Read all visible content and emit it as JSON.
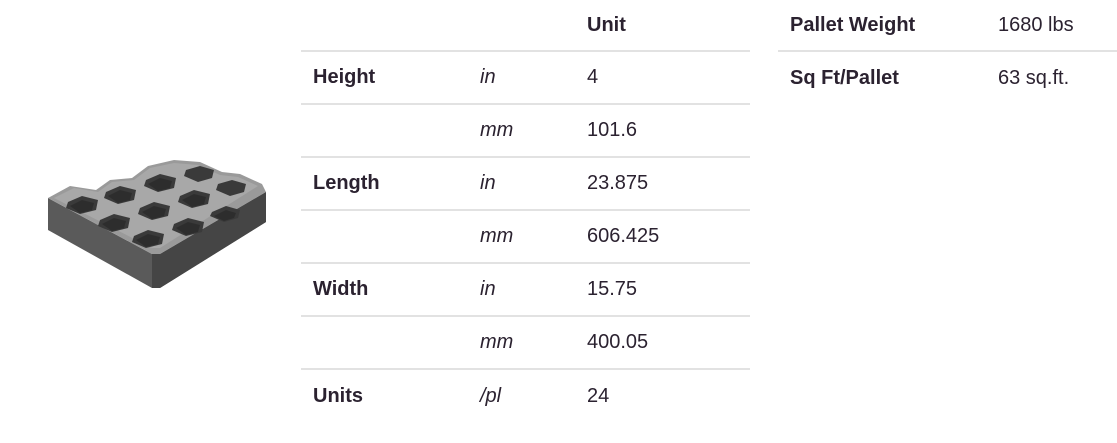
{
  "product": {
    "image_name": "turf-paver-block"
  },
  "spec_table": {
    "header": {
      "unit_label": "Unit"
    },
    "rows": [
      {
        "label": "Height",
        "unit": "in",
        "value": "4"
      },
      {
        "label": "",
        "unit": "mm",
        "value": "101.6"
      },
      {
        "label": "Length",
        "unit": "in",
        "value": "23.875"
      },
      {
        "label": "",
        "unit": "mm",
        "value": "606.425"
      },
      {
        "label": "Width",
        "unit": "in",
        "value": "15.75"
      },
      {
        "label": "",
        "unit": "mm",
        "value": "400.05"
      },
      {
        "label": "Units",
        "unit": "/pl",
        "value": "24"
      }
    ]
  },
  "pallet_table": {
    "rows": [
      {
        "label": "Pallet Weight",
        "value": "1680 lbs"
      },
      {
        "label": "Sq Ft/Pallet",
        "value": "63 sq.ft."
      }
    ]
  },
  "colors": {
    "text": "#2b2230",
    "divider": "#e2e2e2"
  }
}
